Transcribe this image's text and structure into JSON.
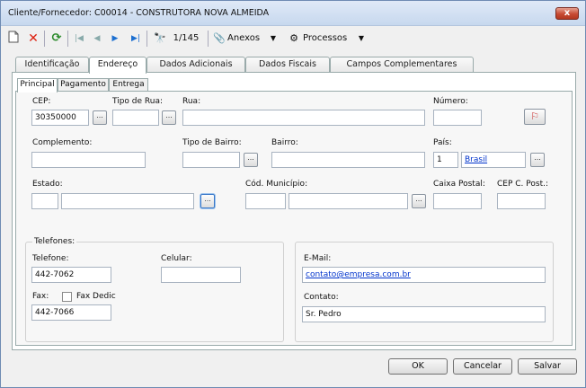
{
  "window": {
    "title": "Cliente/Fornecedor: C00014 - CONSTRUTORA NOVA ALMEIDA",
    "close_symbol": "x"
  },
  "toolbar": {
    "record_position": "1/145",
    "anexos_label": "Anexos",
    "processos_label": "Processos"
  },
  "tabs": [
    "Identificação",
    "Endereço",
    "Dados Adicionais",
    "Dados Fiscais",
    "Campos Complementares"
  ],
  "subtabs": [
    "Principal",
    "Pagamento",
    "Entrega"
  ],
  "address": {
    "cep_label": "CEP:",
    "cep_value": "30350000",
    "tipo_rua_label": "Tipo de Rua:",
    "tipo_rua_value": "",
    "rua_label": "Rua:",
    "rua_value": "",
    "numero_label": "Número:",
    "numero_value": "",
    "complemento_label": "Complemento:",
    "complemento_value": "",
    "tipo_bairro_label": "Tipo de Bairro:",
    "tipo_bairro_value": "",
    "bairro_label": "Bairro:",
    "bairro_value": "",
    "pais_label": "País:",
    "pais_code": "1",
    "pais_name": "Brasil",
    "estado_label": "Estado:",
    "estado_code": "",
    "estado_name": "",
    "municipio_label": "Cód. Município:",
    "municipio_code": "",
    "municipio_name": "",
    "caixa_postal_label": "Caixa Postal:",
    "caixa_postal_value": "",
    "cep_cpost_label": "CEP C. Post.:",
    "cep_cpost_value": "",
    "ellipsis": "..."
  },
  "phones": {
    "group_label": "Telefones:",
    "telefone_label": "Telefone:",
    "telefone_value": "442-7062",
    "celular_label": "Celular:",
    "celular_value": "",
    "fax_label": "Fax:",
    "fax_dedic_label": "Fax Dedic",
    "fax_value": "442-7066"
  },
  "contact": {
    "email_label": "E-Mail:",
    "email_value": "contato@empresa.com.br",
    "contato_label": "Contato:",
    "contato_value": "Sr. Pedro"
  },
  "buttons": {
    "ok": "OK",
    "cancelar": "Cancelar",
    "salvar": "Salvar"
  }
}
